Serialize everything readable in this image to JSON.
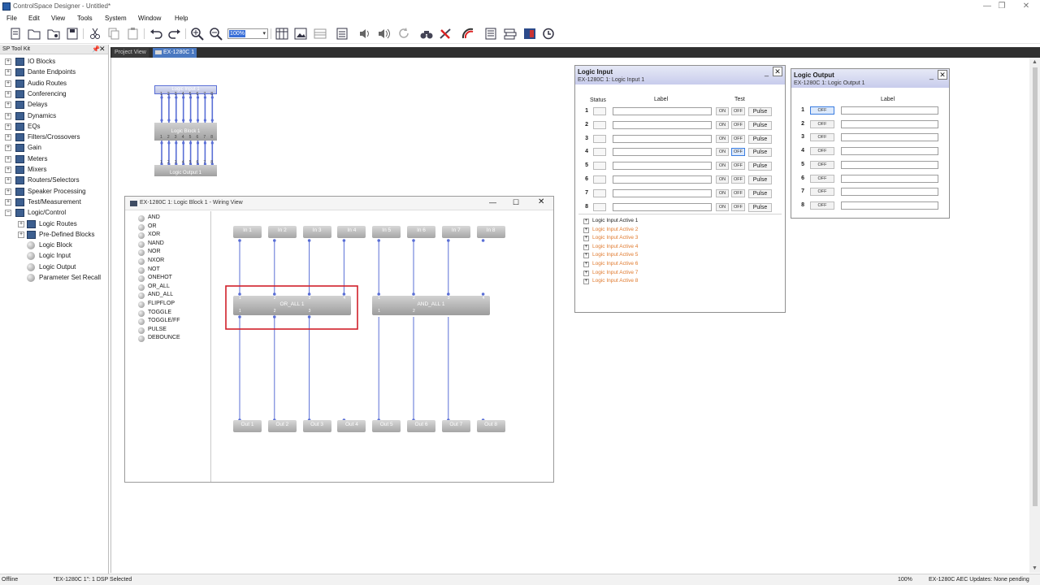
{
  "app": {
    "title": "ControlSpace Designer - Untitled*",
    "window_controls": [
      "—",
      "❐",
      "✕"
    ]
  },
  "menu": [
    "File",
    "Edit",
    "View",
    "Tools",
    "System",
    "Window",
    "Help"
  ],
  "toolbar": {
    "zoom_value": "100%",
    "zoom_arrow": "▾"
  },
  "toolkit": {
    "title": "SP Tool Kit",
    "pin": "📌",
    "close": "✕",
    "items": [
      {
        "label": "IO Blocks",
        "expander": "+"
      },
      {
        "label": "Dante Endpoints",
        "expander": "+"
      },
      {
        "label": "Audio Routes",
        "expander": "+"
      },
      {
        "label": "Conferencing",
        "expander": "+"
      },
      {
        "label": "Delays",
        "expander": "+"
      },
      {
        "label": "Dynamics",
        "expander": "+"
      },
      {
        "label": "EQs",
        "expander": "+"
      },
      {
        "label": "Filters/Crossovers",
        "expander": "+"
      },
      {
        "label": "Gain",
        "expander": "+"
      },
      {
        "label": "Meters",
        "expander": "+"
      },
      {
        "label": "Mixers",
        "expander": "+"
      },
      {
        "label": "Routers/Selectors",
        "expander": "+"
      },
      {
        "label": "Speaker Processing",
        "expander": "+"
      },
      {
        "label": "Test/Measurement",
        "expander": "+"
      },
      {
        "label": "Logic/Control",
        "expander": "−"
      },
      {
        "label": "Logic Routes",
        "expander": "+"
      },
      {
        "label": "Pre-Defined Blocks",
        "expander": "+"
      },
      {
        "label": "Logic Block",
        "expander": ""
      },
      {
        "label": "Logic Input",
        "expander": ""
      },
      {
        "label": "Logic Output",
        "expander": ""
      },
      {
        "label": "Parameter Set Recall",
        "expander": ""
      }
    ]
  },
  "tabs": [
    "Project View",
    "EX-1280C 1"
  ],
  "overview": {
    "input_label": "Logic Input 1",
    "block_label": "Logic Block 1",
    "output_label": "Logic Output 1",
    "pins": [
      "1",
      "2",
      "3",
      "4",
      "5",
      "6",
      "7",
      "8"
    ]
  },
  "logic_input_window": {
    "title": "Logic Input",
    "subtitle": "EX-1280C 1: Logic Input 1",
    "min": "_",
    "close": "✕",
    "col_status": "Status",
    "col_label": "Label",
    "col_test": "Test",
    "on": "ON",
    "off": "OFF",
    "pulse": "Pulse",
    "rows": [
      "1",
      "2",
      "3",
      "4",
      "5",
      "6",
      "7",
      "8"
    ],
    "expander": "+",
    "tree": [
      "Logic Input Active 1",
      "Logic Input Active 2",
      "Logic Input Active 3",
      "Logic Input Active 4",
      "Logic Input Active 5",
      "Logic Input Active 6",
      "Logic Input Active 7",
      "Logic Input Active 8"
    ]
  },
  "logic_output_window": {
    "title": "Logic Output",
    "subtitle": "EX-1280C 1: Logic Output 1",
    "min": "_",
    "close": "✕",
    "col_label": "Label",
    "off": "OFF",
    "rows": [
      "1",
      "2",
      "3",
      "4",
      "5",
      "6",
      "7",
      "8"
    ]
  },
  "wiring_view": {
    "title": "EX-1280C 1: Logic Block 1 - Wiring View",
    "controls": [
      "—",
      "☐",
      "✕"
    ],
    "gates": [
      "AND",
      "OR",
      "XOR",
      "NAND",
      "NOR",
      "NXOR",
      "NOT",
      "ONEHOT",
      "OR_ALL",
      "AND_ALL",
      "FLIPFLOP",
      "TOGGLE",
      "TOGGLE/FF",
      "PULSE",
      "DEBOUNCE"
    ],
    "inputs": [
      "In 1",
      "In 2",
      "In 3",
      "In 4",
      "In 5",
      "In 6",
      "In 7",
      "In 8"
    ],
    "outputs": [
      "Out 1",
      "Out 2",
      "Out 3",
      "Out 4",
      "Out 5",
      "Out 6",
      "Out 7",
      "Out 8"
    ],
    "block_a": "OR_ALL 1",
    "block_b": "AND_ALL 1",
    "block_pins_in": [
      "1",
      "2",
      "3",
      "4"
    ],
    "block_pins_out": [
      "1",
      "2",
      "3"
    ],
    "block_b_pins_out": [
      "1",
      "2"
    ]
  },
  "statusbar": {
    "left": "Offline",
    "device": "\"EX-1280C 1\": 1 DSP Selected",
    "zoom": "100%",
    "aec": "EX-1280C AEC Updates: None pending"
  },
  "colors": {
    "wire": "#5a6fd6",
    "highlight": "#d0202a",
    "orange_text": "#e07a2e"
  }
}
